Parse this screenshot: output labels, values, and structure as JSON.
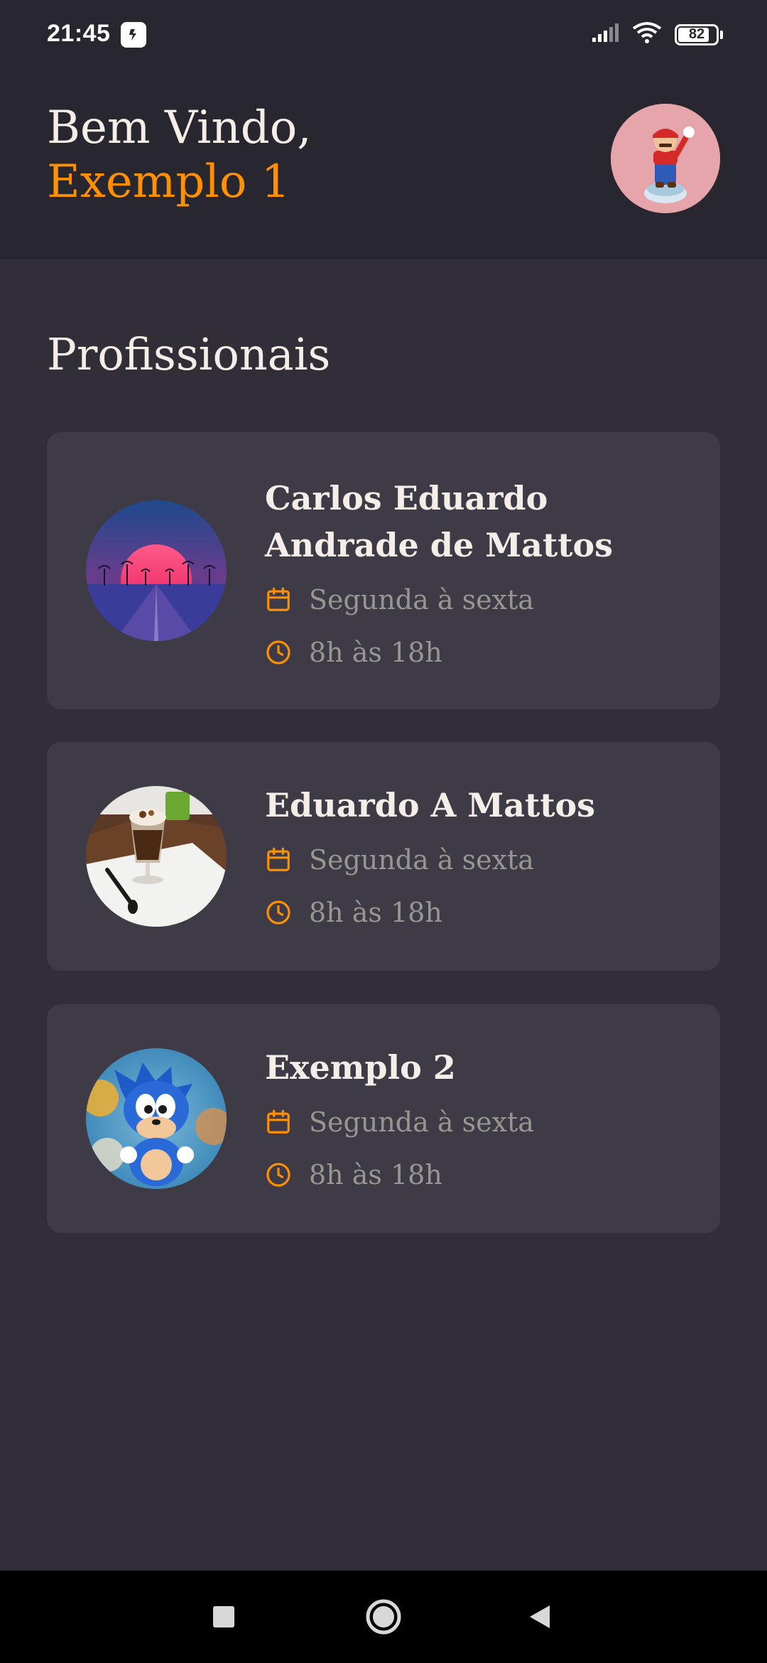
{
  "status_bar": {
    "time": "21:45",
    "battery": "82",
    "battery_level": 0.82,
    "icons": [
      "app-notification-icon",
      "signal-icon",
      "wifi-icon",
      "battery-icon"
    ]
  },
  "header": {
    "greeting": "Bem Vindo,",
    "user_name": "Exemplo 1",
    "avatar_icon": "mario-avatar"
  },
  "section": {
    "title": "Profissionais"
  },
  "providers": [
    {
      "name": "Carlos Eduardo Andrade de Mattos",
      "days": "Segunda à sexta",
      "hours": "8h às 18h",
      "photo": "sunset-palms-photo"
    },
    {
      "name": "Eduardo A Mattos",
      "days": "Segunda à sexta",
      "hours": "8h às 18h",
      "photo": "coffee-dessert-photo"
    },
    {
      "name": "Exemplo 2",
      "days": "Segunda à sexta",
      "hours": "8h às 18h",
      "photo": "sonic-figure-photo"
    }
  ],
  "nav_bar": {
    "icons": [
      "recents-square-icon",
      "home-circle-icon",
      "back-triangle-icon"
    ]
  },
  "colors": {
    "background": "#312e38",
    "header": "#28262e",
    "card": "#3e3b47",
    "accent": "#ff9000",
    "text": "#f4ede8",
    "muted": "#999591"
  }
}
